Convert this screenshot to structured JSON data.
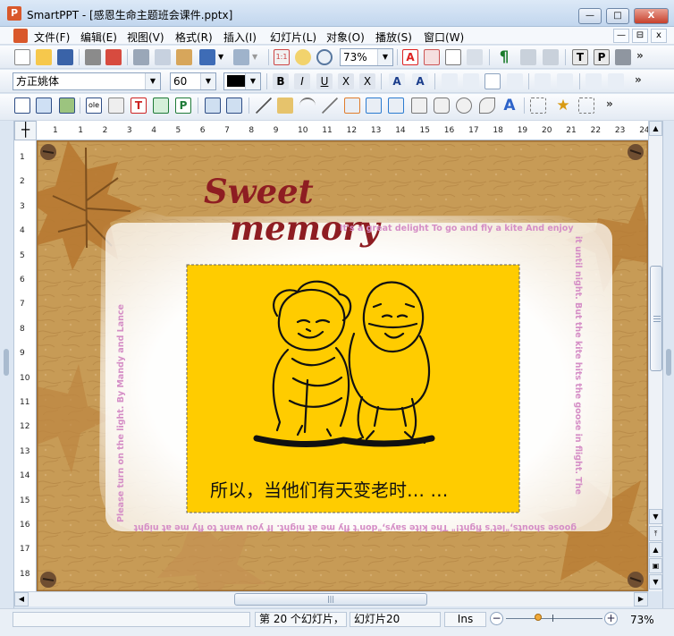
{
  "window": {
    "app_icon": "P",
    "title": "SmartPPT - [感恩生命主题班会课件.pptx]",
    "buttons": {
      "minimize": "—",
      "maximize": "□",
      "close": "X"
    }
  },
  "menu": {
    "items": [
      "文件(F)",
      "编辑(E)",
      "视图(V)",
      "格式(R)",
      "插入(I)",
      "幻灯片(L)",
      "对象(O)",
      "播放(S)",
      "窗口(W)"
    ],
    "mdi_buttons": [
      "—",
      "⊟",
      "x"
    ]
  },
  "toolbar1": {
    "zoom_value": "73%"
  },
  "toolbar2": {
    "font_name": "方正姚体",
    "font_size": "60"
  },
  "rulers": {
    "h_numbers": [
      "1",
      "1",
      "2",
      "3",
      "4",
      "5",
      "6",
      "7",
      "8",
      "9",
      "10",
      "11",
      "12",
      "13",
      "14",
      "15",
      "16",
      "17",
      "18",
      "19",
      "20",
      "21",
      "22",
      "23",
      "24"
    ],
    "v_numbers": [
      "1",
      "2",
      "3",
      "4",
      "5",
      "6",
      "7",
      "8",
      "9",
      "10",
      "11",
      "12",
      "13",
      "14",
      "15",
      "16",
      "17",
      "18"
    ],
    "corner_symbol": "┼"
  },
  "slide": {
    "title_line1": "Sweet",
    "title_line2": "memory",
    "border_top": "It's a great delight To go and fly a kite And enjoy",
    "border_right": "it until night. But the kite hits the goose in flight. The",
    "border_bottom": "goose shouts,\"let's fight!\" The kite says,\"don't fly me at night. If you want to fly me at night",
    "border_left": "Please turn on the light. By Mandy and Lance",
    "caption": "所以，当他们有天变老时… …"
  },
  "status": {
    "cell1": "",
    "cell2": "第 20 个幻灯片，",
    "cell3": "幻灯片20",
    "cell4": "Ins",
    "zoom_minus": "−",
    "zoom_plus": "+",
    "zoom_level": "73%"
  },
  "scroll": {
    "h_thumb_grip": "|||"
  },
  "colors": {
    "slide_yellow": "#ffcc00",
    "title_red": "#8e1d22",
    "border_text": "#d58ec6",
    "leaf_brown": "#b77932"
  }
}
